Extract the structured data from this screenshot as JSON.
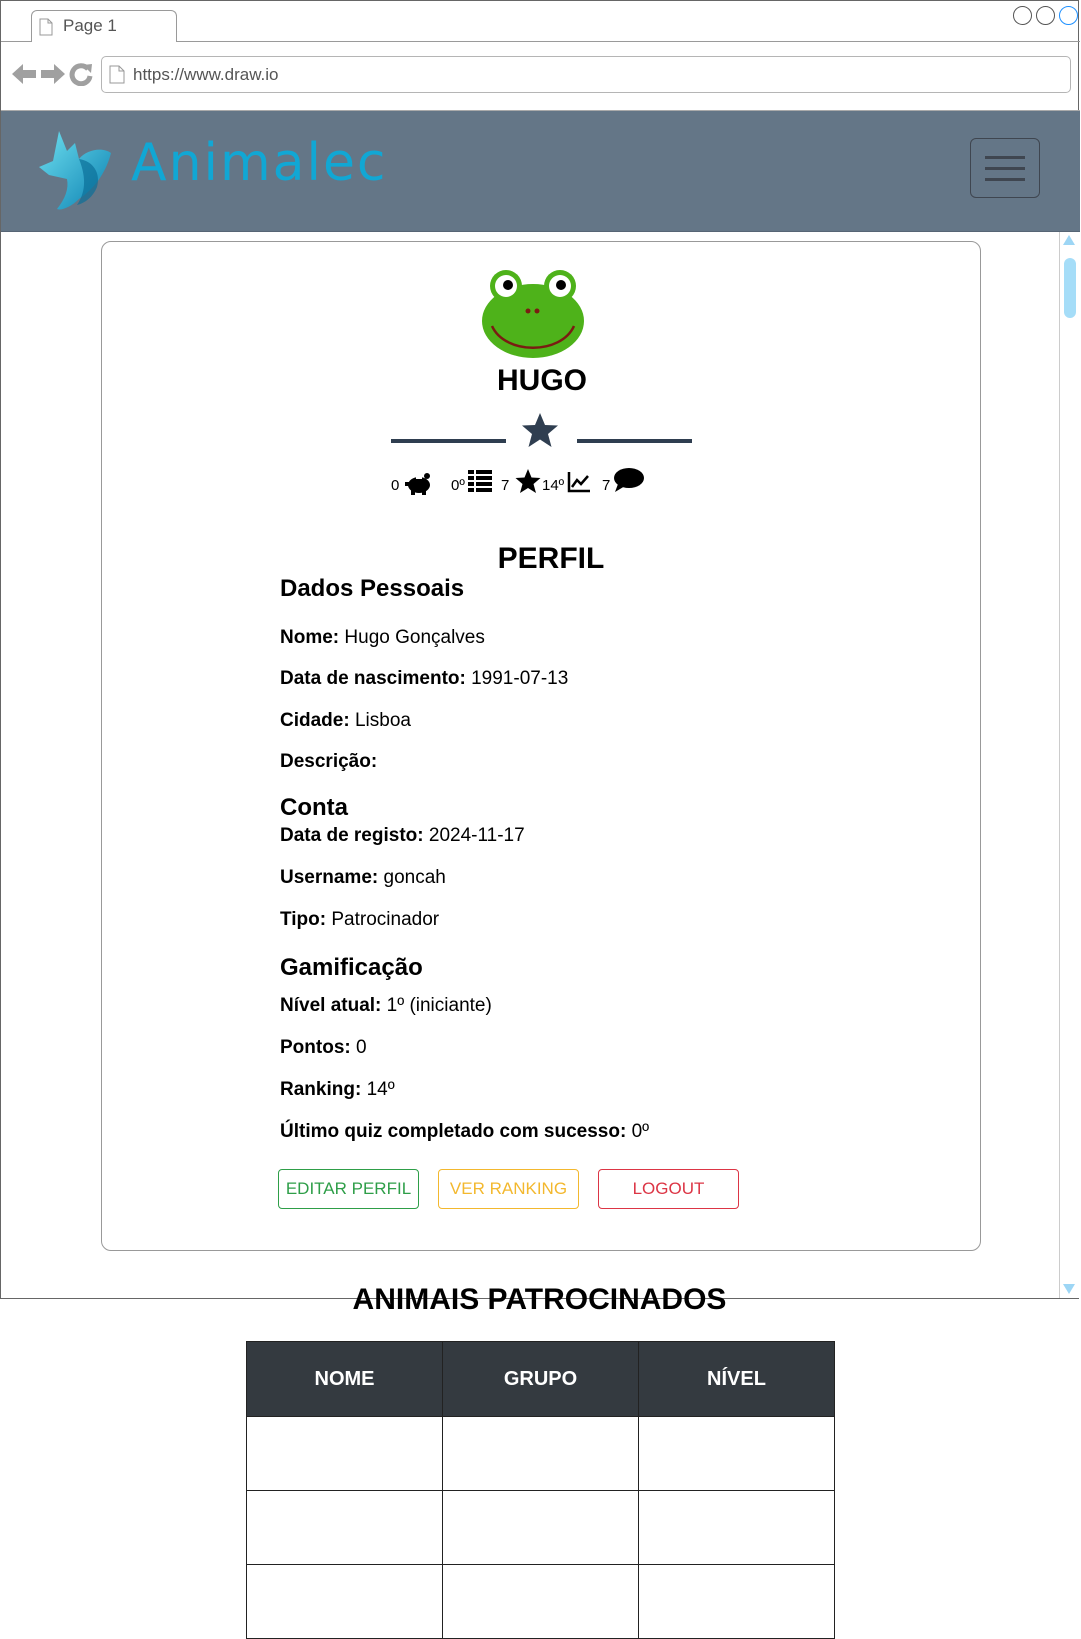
{
  "browser": {
    "tab_label": "Page 1",
    "url": "https://www.draw.io"
  },
  "header": {
    "brand": "Animalec",
    "accent_color": "#11a7d4",
    "bar_color": "#647687"
  },
  "profile": {
    "name": "HUGO",
    "stats": {
      "points": "0",
      "quiz": "0º",
      "stars": "7",
      "ranking": "14º",
      "comments": "7"
    },
    "title": "PERFIL",
    "sections": {
      "personal": {
        "title": "Dados Pessoais",
        "fields": [
          {
            "label": "Nome:",
            "value": "Hugo Gonçalves"
          },
          {
            "label": "Data de nascimento:",
            "value": "1991-07-13"
          },
          {
            "label": "Cidade:",
            "value": "Lisboa"
          },
          {
            "label": "Descrição:",
            "value": ""
          }
        ]
      },
      "account": {
        "title": "Conta",
        "fields": [
          {
            "label": "Data de registo:",
            "value": "2024-11-17"
          },
          {
            "label": "Username:",
            "value": "goncah"
          },
          {
            "label": "Tipo:",
            "value": "Patrocinador"
          }
        ]
      },
      "gamification": {
        "title": "Gamificação",
        "fields": [
          {
            "label": "Nível atual:",
            "value": "1º (iniciante)"
          },
          {
            "label": "Pontos:",
            "value": "0"
          },
          {
            "label": "Ranking:",
            "value": "14º"
          },
          {
            "label": "Último quiz completado com sucesso:",
            "value": "0º"
          }
        ]
      }
    },
    "buttons": {
      "edit": "EDITAR PERFIL",
      "ranking": "VER RANKING",
      "logout": "LOGOUT"
    }
  },
  "sponsored": {
    "title": "ANIMAIS PATROCINADOS",
    "columns": [
      "NOME",
      "GRUPO",
      "NÍVEL"
    ]
  },
  "colors": {
    "edit_button": "#2e9e48",
    "ranking_button": "#f3b82e",
    "logout_button": "#dc3545",
    "table_header": "#343a40"
  }
}
